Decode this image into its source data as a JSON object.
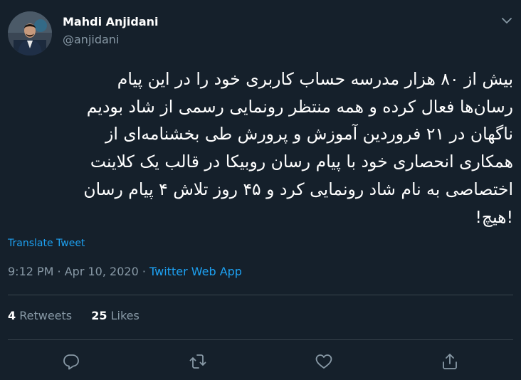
{
  "author": {
    "name": "Mahdi Anjidani",
    "handle": "@anjidani"
  },
  "tweet": {
    "lines": [
      "بیش از ۸۰ هزار مدرسه حساب کاربری خود را در این پیام",
      "رسان‌ها فعال کرده و همه منتظر رونمایی رسمی از شاد بودیم",
      "ناگهان در ۲۱ فروردین آموزش و پرورش طی بخشنامه‌ای از",
      "همکاری انحصاری خود با پیام رسان روبیکا در قالب یک کلاینت",
      "اختصاصی به نام شاد رونمایی کرد و ۴۵ روز تلاش ۴ پیام رسان",
      "!هیچ!"
    ],
    "translate_label": "Translate Tweet",
    "time": "9:12 PM",
    "separator": " · ",
    "date": "Apr 10, 2020",
    "source": "Twitter Web App"
  },
  "stats": {
    "retweets_count": "4",
    "retweets_label": "Retweets",
    "likes_count": "25",
    "likes_label": "Likes"
  },
  "icons": {
    "menu": "chevron-down-icon",
    "reply": "reply-icon",
    "retweet": "retweet-icon",
    "like": "like-icon",
    "share": "share-icon"
  },
  "colors": {
    "background": "#15202b",
    "text": "#ffffff",
    "secondary": "#8899a6",
    "accent": "#1da1f2",
    "divider": "#38444d"
  }
}
